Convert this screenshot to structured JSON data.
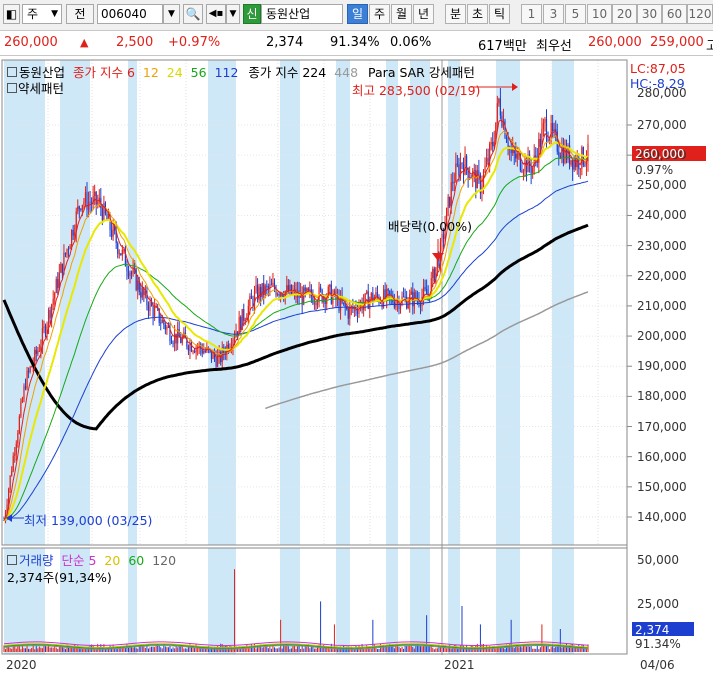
{
  "toolbar": {
    "market": "주",
    "prev": "전",
    "code": "006040",
    "new_badge": "신",
    "stock_name": "동원산업",
    "periods": [
      "일",
      "주",
      "월",
      "년",
      "분",
      "초",
      "틱"
    ],
    "selected_period": "일",
    "numbers": [
      "1",
      "3",
      "5",
      "10",
      "20",
      "30",
      "60",
      "120"
    ]
  },
  "quote": {
    "price": "260,000",
    "change": "2,500",
    "change_pct": "+0.97%",
    "volume": "2,374",
    "volume_ratio": "91.34%",
    "turnover": "0.06%",
    "amount": "617백만",
    "best_ask_label": "최우선",
    "ask": "260,000",
    "bid": "259,000",
    "high_label": "고"
  },
  "legend": {
    "stock": "동원산업",
    "ma_label": "종가 지수 6",
    "ma12": "12",
    "ma24": "24",
    "ma56": "56",
    "ma112": "112",
    "ma224_label": "종가 지수 224",
    "ma448": "448",
    "psar": "Para SAR",
    "pattern": "강세패턴",
    "pattern2": "약세패턴",
    "lc": "LC:87,05",
    "hc": "HC:-8,29"
  },
  "annotations": {
    "high": "최고 283,500 (02/19)",
    "low": "최저 139,000 (03/25)",
    "dividend": "배당락(0.00%)"
  },
  "volume_panel": {
    "label": "거래량",
    "ma_label": "단순 5",
    "ma20": "20",
    "ma60": "60",
    "ma120": "120",
    "current": "2,374주(91,34%)",
    "axis_current": "2,374",
    "axis_pct": "91.34%"
  },
  "price_axis": [
    "270,000",
    "260,000",
    "250,000",
    "240,000",
    "230,000",
    "220,000",
    "210,000",
    "200,000",
    "190,000",
    "180,000",
    "170,000",
    "160,000",
    "150,000",
    "140,000"
  ],
  "price_axis_top": "280,000",
  "current_price_tag": "260,000",
  "current_pct_tag": "0.97%",
  "volume_axis": [
    "50,000",
    "25,000"
  ],
  "x_axis": {
    "left": "2020",
    "mid": "2021",
    "right": "04/06"
  },
  "colors": {
    "up": "#e0201a",
    "down": "#1c3fd0",
    "shade": "#cfe8f8",
    "ma6": "#e0201a",
    "ma12": "#f0a000",
    "ma24": "#e8e800",
    "ma56": "#17a817",
    "ma112": "#1c3fd0",
    "ma224": "#000000",
    "ma448": "#999999"
  }
}
